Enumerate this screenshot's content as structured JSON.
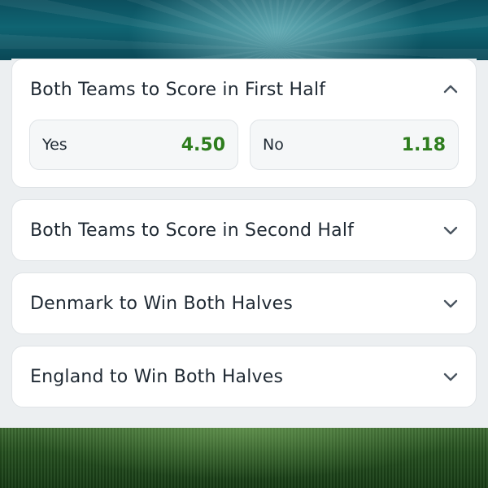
{
  "markets": [
    {
      "title": "Both Teams to Score in First Half",
      "expanded": true,
      "chevron_icon": "chevron-up-icon",
      "selections": [
        {
          "label": "Yes",
          "odds": "4.50"
        },
        {
          "label": "No",
          "odds": "1.18"
        }
      ]
    },
    {
      "title": "Both Teams to Score in Second Half",
      "expanded": false,
      "chevron_icon": "chevron-down-icon"
    },
    {
      "title": "Denmark to Win Both Halves",
      "expanded": false,
      "chevron_icon": "chevron-down-icon"
    },
    {
      "title": "England to Win Both Halves",
      "expanded": false,
      "chevron_icon": "chevron-down-icon"
    }
  ],
  "colors": {
    "odds_green": "#2e7d1e",
    "text": "#1f2933",
    "card_bg": "#ffffff",
    "page_bg": "#eceff1",
    "chevron": "#4a5560"
  }
}
